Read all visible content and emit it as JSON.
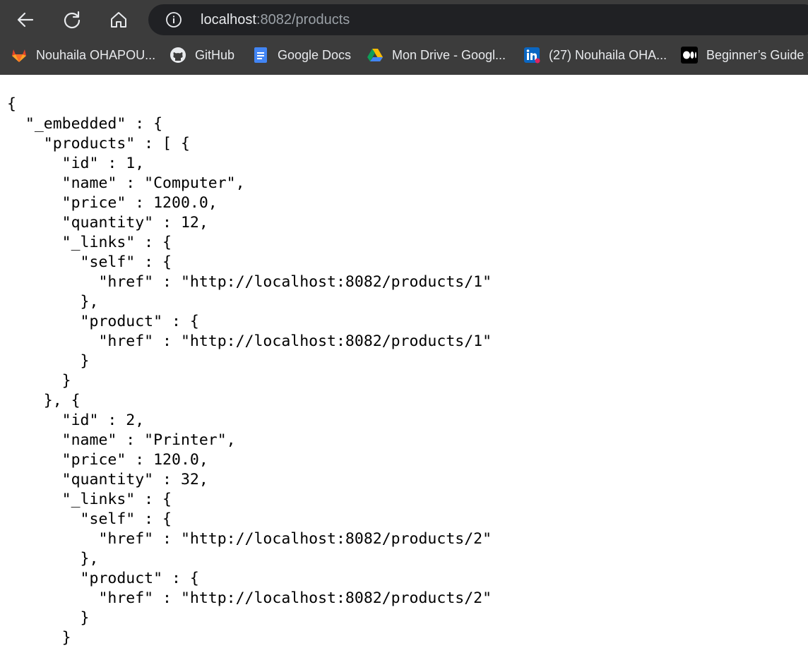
{
  "browser": {
    "url_host": "localhost",
    "url_path": ":8082/products",
    "nav": {
      "back_icon": "arrow-left-icon",
      "reload_icon": "reload-icon",
      "home_icon": "home-icon",
      "site_info_icon": "info-icon"
    },
    "bookmarks": [
      {
        "label": "Nouhaila OHAPOU...",
        "icon": "gitlab-icon",
        "color": "#e24329"
      },
      {
        "label": "GitHub",
        "icon": "github-icon",
        "color": "#e8eaed"
      },
      {
        "label": "Google Docs",
        "icon": "google-docs-icon",
        "color": "#4285f4"
      },
      {
        "label": "Mon Drive - Googl...",
        "icon": "google-drive-icon",
        "color": "#0f9d58"
      },
      {
        "label": "(27) Nouhaila OHA...",
        "icon": "linkedin-icon",
        "color": "#0a66c2"
      },
      {
        "label": "Beginner’s Guide t",
        "icon": "medium-icon",
        "color": "#ffffff"
      }
    ]
  },
  "colors": {
    "chrome_bg": "#3c3c3c",
    "omnibox_bg": "#202124",
    "text_light": "#e8eaed",
    "text_dim": "#9aa0a6"
  },
  "json_view": {
    "text": "{\n  \"_embedded\" : {\n    \"products\" : [ {\n      \"id\" : 1,\n      \"name\" : \"Computer\",\n      \"price\" : 1200.0,\n      \"quantity\" : 12,\n      \"_links\" : {\n        \"self\" : {\n          \"href\" : \"http://localhost:8082/products/1\"\n        },\n        \"product\" : {\n          \"href\" : \"http://localhost:8082/products/1\"\n        }\n      }\n    }, {\n      \"id\" : 2,\n      \"name\" : \"Printer\",\n      \"price\" : 120.0,\n      \"quantity\" : 32,\n      \"_links\" : {\n        \"self\" : {\n          \"href\" : \"http://localhost:8082/products/2\"\n        },\n        \"product\" : {\n          \"href\" : \"http://localhost:8082/products/2\"\n        }\n      }"
  }
}
